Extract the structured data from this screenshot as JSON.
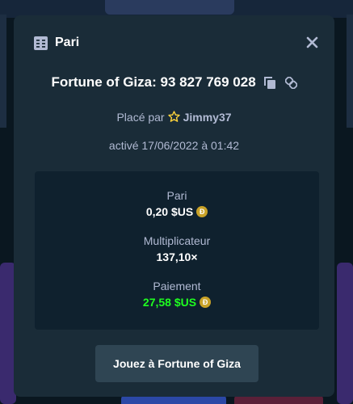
{
  "modal": {
    "title": "Pari",
    "header_icon": "bet-slip-icon",
    "close_icon": "close-icon"
  },
  "bet": {
    "game_title": "Fortune of Giza: 93 827 769 028",
    "copy_icon": "copy-icon",
    "link_icon": "link-icon",
    "placed_by_label": "Placé par",
    "username": "Jimmy37",
    "user_icon": "star-icon",
    "date_text": "activé 17/06/2022 à 01:42"
  },
  "stats": {
    "bet_label": "Pari",
    "bet_value": "0,20 $US",
    "multiplier_label": "Multiplicateur",
    "multiplier_value": "137,10×",
    "payout_label": "Paiement",
    "payout_value": "27,58 $US",
    "currency_icon": "dogecoin-icon"
  },
  "actions": {
    "play_label": "Jouez à Fortune of Giza"
  },
  "colors": {
    "modal_bg": "#1a2c38",
    "stats_bg": "#0f212e",
    "button_bg": "#2f4553",
    "muted_text": "#b1bad3",
    "payout_green": "#1fff20",
    "coin_gold": "#c9a227",
    "star_yellow": "#ffd43b"
  }
}
